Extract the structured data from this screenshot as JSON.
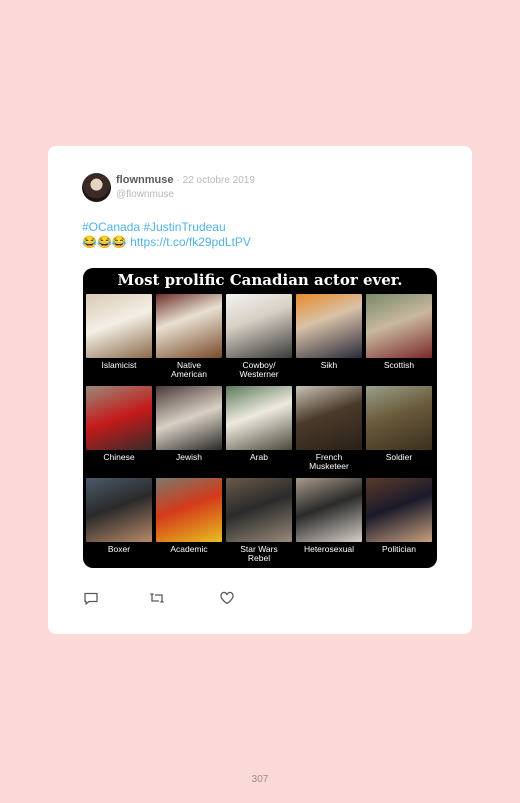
{
  "tweet": {
    "name": "flownmuse",
    "date": "· 22 octobre 2019",
    "handle": "@flownmuse",
    "hashtags": "#OCanada #JustinTrudeau",
    "emojis": "😂😂😂",
    "link": "https://t.co/fk29pdLtPV"
  },
  "meme": {
    "title": "Most prolific Canadian actor ever.",
    "cells": [
      {
        "caption": "Islamicist",
        "bg": "linear-gradient(160deg,#d9c9b4,#f4efe6 45%,#8a6a4a)"
      },
      {
        "caption": "Native\nAmerican",
        "bg": "linear-gradient(160deg,#6d2f2a,#e8e0d2 40%,#7a4a2a)"
      },
      {
        "caption": "Cowboy/\nWesterner",
        "bg": "linear-gradient(160deg,#f2f2f2,#d8d0c4 40%,#3a3a3a)"
      },
      {
        "caption": "Sikh",
        "bg": "linear-gradient(160deg,#e88a2a,#d9c2a8 40%,#2a2a3a)"
      },
      {
        "caption": "Scottish",
        "bg": "linear-gradient(160deg,#7a8a6a,#c9b8a0 45%,#7a2a2a)"
      },
      {
        "caption": "Chinese",
        "bg": "linear-gradient(160deg,#9a8a7a,#c41a1a 50%,#3a2a2a)"
      },
      {
        "caption": "Jewish",
        "bg": "linear-gradient(160deg,#4a3a3a,#d9d0c4 50%,#2a2a2a)"
      },
      {
        "caption": "Arab",
        "bg": "linear-gradient(160deg,#5a7a5a,#efeae0 45%,#4a4a3a)"
      },
      {
        "caption": "French\nMusketeer",
        "bg": "linear-gradient(160deg,#c9c4b8,#4a3a2a 45%,#2a2018)"
      },
      {
        "caption": "Soldier",
        "bg": "linear-gradient(160deg,#9aa08a,#6a5a3a 45%,#3a3020)"
      },
      {
        "caption": "Boxer",
        "bg": "linear-gradient(160deg,#4a5a6a,#2a2a2a 45%,#b88a6a)"
      },
      {
        "caption": "Academic",
        "bg": "linear-gradient(160deg,#7a7a6a,#d43a1a 45%,#e8c020)"
      },
      {
        "caption": "Star Wars\nRebel",
        "bg": "linear-gradient(160deg,#6a5a4a,#2a2a2a 45%,#9a8a7a)"
      },
      {
        "caption": "Heterosexual",
        "bg": "linear-gradient(160deg,#a89a8a,#2a2a2a 45%,#d8d0c8)"
      },
      {
        "caption": "Politician",
        "bg": "linear-gradient(160deg,#5a3a2a,#1a1a2a 45%,#c9a080)"
      }
    ]
  },
  "icons": [
    "reply-icon",
    "retweet-icon",
    "like-icon"
  ],
  "page_number": "307"
}
